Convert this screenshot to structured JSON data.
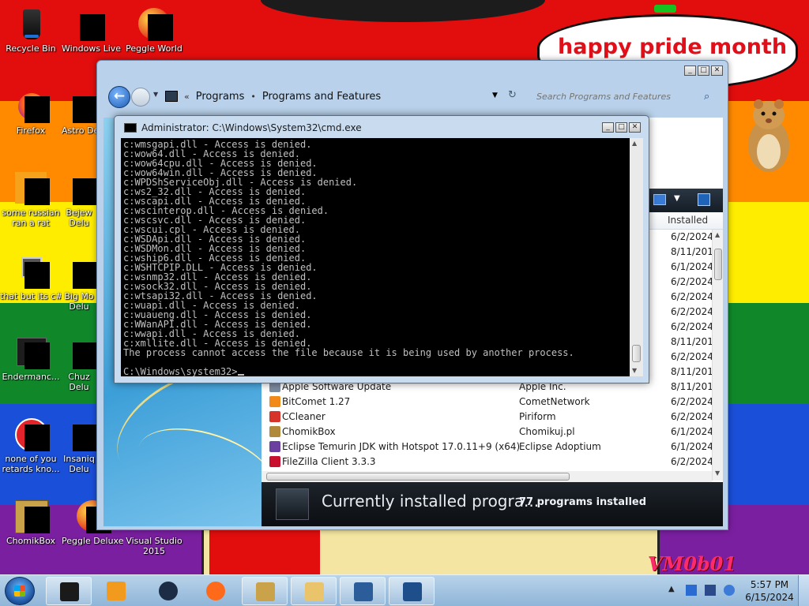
{
  "wallpaper": {
    "bubble_text": "happy pride month",
    "logo_text": "VM0b01"
  },
  "desktop_icons": [
    {
      "label": "Recycle Bin",
      "icon": "recycle-bin-icon"
    },
    {
      "label": "Windows Live Ma",
      "icon": "windows-live-icon"
    },
    {
      "label": "Peggle World",
      "icon": "peggle-icon"
    },
    {
      "label": "Firefox",
      "icon": "firefox-icon"
    },
    {
      "label": "Astro Delu",
      "icon": "astro-icon"
    },
    {
      "label": "some russian ran a rat",
      "icon": "app-icon"
    },
    {
      "label": "Bejew Delu",
      "icon": "bejeweled-icon"
    },
    {
      "label": "that but its c#",
      "icon": "folder-icon"
    },
    {
      "label": "Big Mo Delu",
      "icon": "game-icon"
    },
    {
      "label": "Endermanc...",
      "icon": "app-icon"
    },
    {
      "label": "Chuz Delu",
      "icon": "game-icon"
    },
    {
      "label": "none of you retards kno...",
      "icon": "app-icon"
    },
    {
      "label": "Insaniq Delu",
      "icon": "game-icon"
    },
    {
      "label": "ChomikBox",
      "icon": "chomikbox-icon"
    },
    {
      "label": "Peggle Deluxe",
      "icon": "peggle-icon"
    },
    {
      "label": "Visual Studio 2015",
      "icon": "visual-studio-icon"
    }
  ],
  "explorer": {
    "breadcrumb": [
      "Programs",
      "Programs and Features"
    ],
    "search_placeholder": "Search Programs and Features",
    "column_installed": "Installed",
    "rows": [
      {
        "name": "",
        "publisher": "",
        "date": "6/2/2024"
      },
      {
        "name": "",
        "publisher": "",
        "date": "8/11/201"
      },
      {
        "name": "",
        "publisher": "",
        "date": "6/1/2024"
      },
      {
        "name": "",
        "publisher": "",
        "date": "6/2/2024"
      },
      {
        "name": "",
        "publisher": "",
        "date": "6/2/2024"
      },
      {
        "name": "",
        "publisher": "",
        "date": "6/2/2024"
      },
      {
        "name": "",
        "publisher": "",
        "date": "6/2/2024"
      },
      {
        "name": "",
        "publisher": "",
        "date": "8/11/201"
      },
      {
        "name": "",
        "publisher": "",
        "date": "6/2/2024"
      },
      {
        "name": "",
        "publisher": "",
        "date": "8/11/201"
      },
      {
        "name": "Apple Software Update",
        "publisher": "Apple Inc.",
        "date": "8/11/201"
      },
      {
        "name": "BitComet 1.27",
        "publisher": "CometNetwork",
        "date": "6/2/2024"
      },
      {
        "name": "CCleaner",
        "publisher": "Piriform",
        "date": "6/2/2024"
      },
      {
        "name": "ChomikBox",
        "publisher": "Chomikuj.pl",
        "date": "6/1/2024"
      },
      {
        "name": "Eclipse Temurin JDK with Hotspot 17.0.11+9 (x64)",
        "publisher": "Eclipse Adoptium",
        "date": "6/1/2024"
      },
      {
        "name": "FileZilla Client 3.3.3",
        "publisher": "",
        "date": "6/2/2024"
      }
    ],
    "details_title": "Currently installed progra...",
    "details_count": "77 programs installed"
  },
  "cmd": {
    "title": "Administrator: C:\\Windows\\System32\\cmd.exe",
    "lines": [
      "c:wmsgapi.dll - Access is denied.",
      "c:wow64.dll - Access is denied.",
      "c:wow64cpu.dll - Access is denied.",
      "c:wow64win.dll - Access is denied.",
      "c:WPDShServiceObj.dll - Access is denied.",
      "c:ws2_32.dll - Access is denied.",
      "c:wscapi.dll - Access is denied.",
      "c:wscinterop.dll - Access is denied.",
      "c:wscsvc.dll - Access is denied.",
      "c:wscui.cpl - Access is denied.",
      "c:WSDApi.dll - Access is denied.",
      "c:WSDMon.dll - Access is denied.",
      "c:wship6.dll - Access is denied.",
      "c:WSHTCPIP.DLL - Access is denied.",
      "c:wsnmp32.dll - Access is denied.",
      "c:wsock32.dll - Access is denied.",
      "c:wtsapi32.dll - Access is denied.",
      "c:wuapi.dll - Access is denied.",
      "c:wuaueng.dll - Access is denied.",
      "c:WWanAPI.dll - Access is denied.",
      "c:wwapi.dll - Access is denied.",
      "c:xmllite.dll - Access is denied.",
      "The process cannot access the file because it is being used by another process."
    ],
    "prompt": "C:\\Windows\\system32>"
  },
  "taskbar": {
    "apps": [
      {
        "name": "cmd-taskbar-icon",
        "color": "#1a1a1a"
      },
      {
        "name": "media-player-taskbar-icon",
        "color": "#f29a1e"
      },
      {
        "name": "game-taskbar-icon",
        "color": "#1b2c44"
      },
      {
        "name": "firefox-taskbar-icon",
        "color": "#ff6a1a"
      },
      {
        "name": "chomikbox-taskbar-icon",
        "color": "#c9a24a"
      },
      {
        "name": "explorer-taskbar-icon",
        "color": "#e9c46a"
      },
      {
        "name": "control-panel-taskbar-icon",
        "color": "#2b5d9a"
      },
      {
        "name": "cmd-active-taskbar-icon",
        "color": "#1f4f8a"
      }
    ],
    "clock_time": "5:57 PM",
    "clock_date": "6/15/2024"
  }
}
